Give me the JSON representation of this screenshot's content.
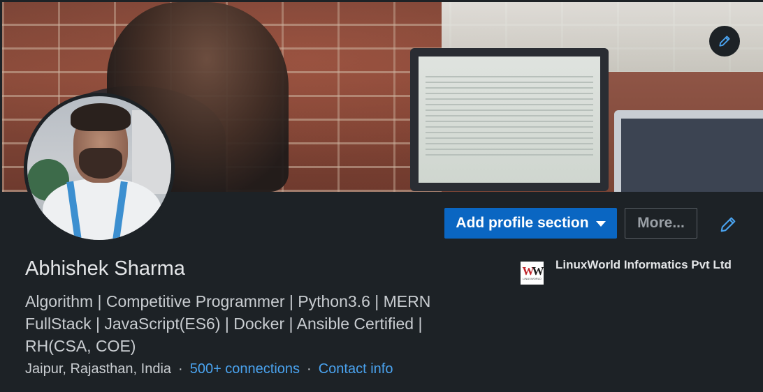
{
  "profile": {
    "name": "Abhishek Sharma",
    "headline": "Algorithm | Competitive Programmer | Python3.6 | MERN FullStack | JavaScript(ES6) | Docker | Ansible Certified | RH(CSA, COE)",
    "location": "Jaipur, Rajasthan, India",
    "separator": "·",
    "connections_label": "500+ connections",
    "contact_label": "Contact info"
  },
  "actions": {
    "add_section_label": "Add profile section",
    "more_label": "More..."
  },
  "company": {
    "name": "LinuxWorld Informatics Pvt Ltd",
    "logo_text": "LINUXWORLD"
  },
  "icons": {
    "banner_edit": "pencil-icon",
    "intro_edit": "pencil-icon",
    "dropdown": "caret-down-icon"
  },
  "colors": {
    "background": "#1d2226",
    "primary_button": "#0a66c2",
    "link": "#4aa3ef",
    "text_primary": "#e4e6e8",
    "text_secondary": "#c9cdd1"
  }
}
